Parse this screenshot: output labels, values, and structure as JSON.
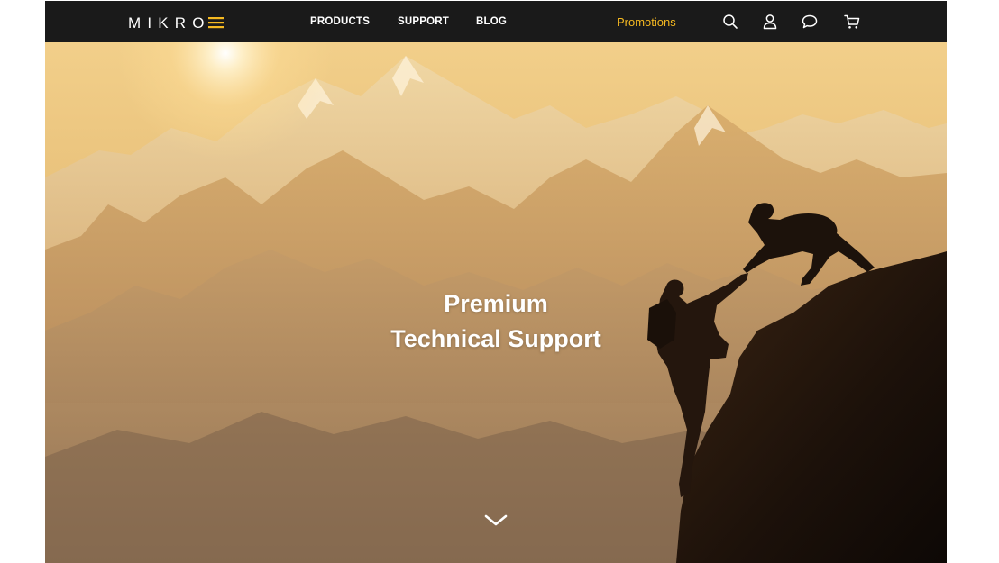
{
  "header": {
    "logo_text": "MIKROE",
    "nav": [
      {
        "label": "PRODUCTS"
      },
      {
        "label": "SUPPORT"
      },
      {
        "label": "BLOG"
      }
    ],
    "promotions_label": "Promotions",
    "icons": [
      "search-icon",
      "user-icon",
      "chat-icon",
      "cart-icon"
    ]
  },
  "hero": {
    "title_line1": "Premium",
    "title_line2": "Technical Support"
  },
  "colors": {
    "navbar": "#1a1a1a",
    "accent": "#f5b921",
    "text": "#ffffff"
  }
}
